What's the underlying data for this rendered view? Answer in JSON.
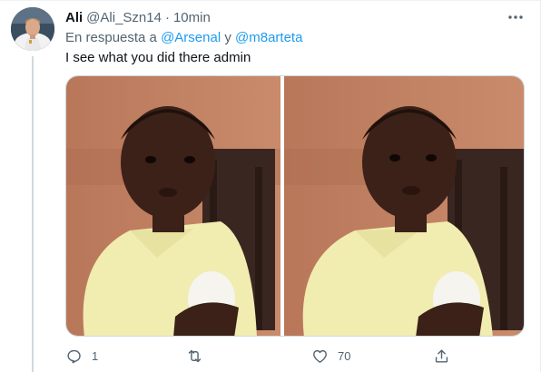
{
  "tweet": {
    "author_name": "Ali",
    "author_handle": "@Ali_Szn14",
    "separator": "·",
    "timestamp": "10min",
    "reply_prefix": "En respuesta a",
    "reply_mention_1": "@Arsenal",
    "reply_conjunction": "y",
    "reply_mention_2": "@m8arteta",
    "text": "I see what you did there admin"
  },
  "actions": {
    "reply_count": "1",
    "retweet_count": "",
    "like_count": "70"
  },
  "icons": {
    "more": "more-horizontal-icon",
    "reply": "reply-bubble-icon",
    "retweet": "retweet-arrows-icon",
    "like": "heart-icon",
    "share": "share-upload-icon"
  },
  "colors": {
    "link": "#1d9bf0",
    "secondary_text": "#536471",
    "primary_text": "#0f1419"
  }
}
